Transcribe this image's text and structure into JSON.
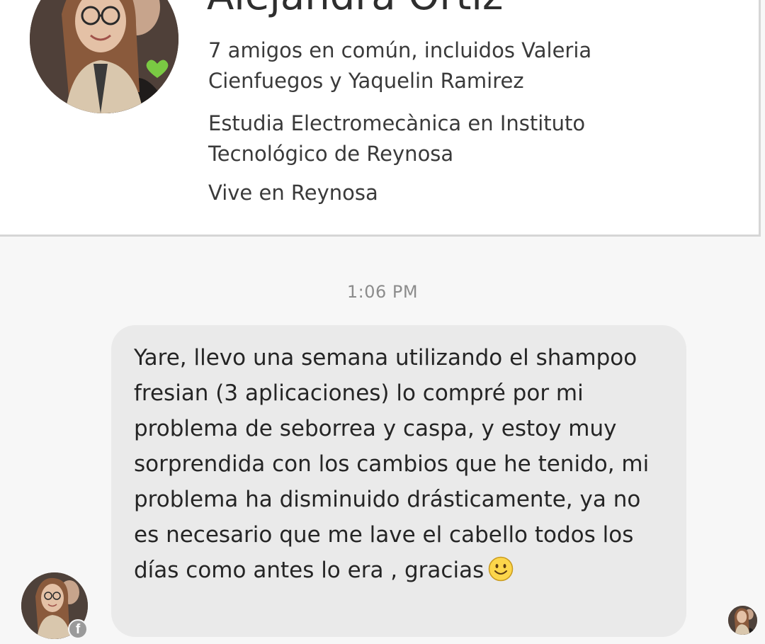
{
  "profile": {
    "name": "Alejandra Ortiz",
    "mutual_friends": "7 amigos en común, incluidos Valeria Cienfuegos y Yaquelin Ramirez",
    "education": "Estudia Electromecànica en Instituto Tecnológico de Reynosa",
    "location": "Vive en Reynosa"
  },
  "conversation": {
    "timestamp": "1:06 PM",
    "message": {
      "text": "Yare, llevo una semana utilizando el shampoo fresian (3 aplicaciones) lo compré por mi problema de seborrea y caspa, y estoy muy sorprendida con los cambios que he tenido, mi problema ha disminuido drásticamente, ya no es necesario que me lave el cabello todos los días como antes lo era , gracias",
      "emoji": "smiley-face-icon"
    }
  },
  "icons": {
    "profile_avatar": "profile-photo",
    "sender_avatar": "profile-photo",
    "fb_badge": "facebook-icon",
    "fb_badge_glyph": "f",
    "seen_avatar": "seen-indicator-photo"
  },
  "colors": {
    "background": "#f7f7f7",
    "card": "#ffffff",
    "bubble": "#eaeaea",
    "timestamp": "#8c8c8c",
    "text": "#252525"
  }
}
